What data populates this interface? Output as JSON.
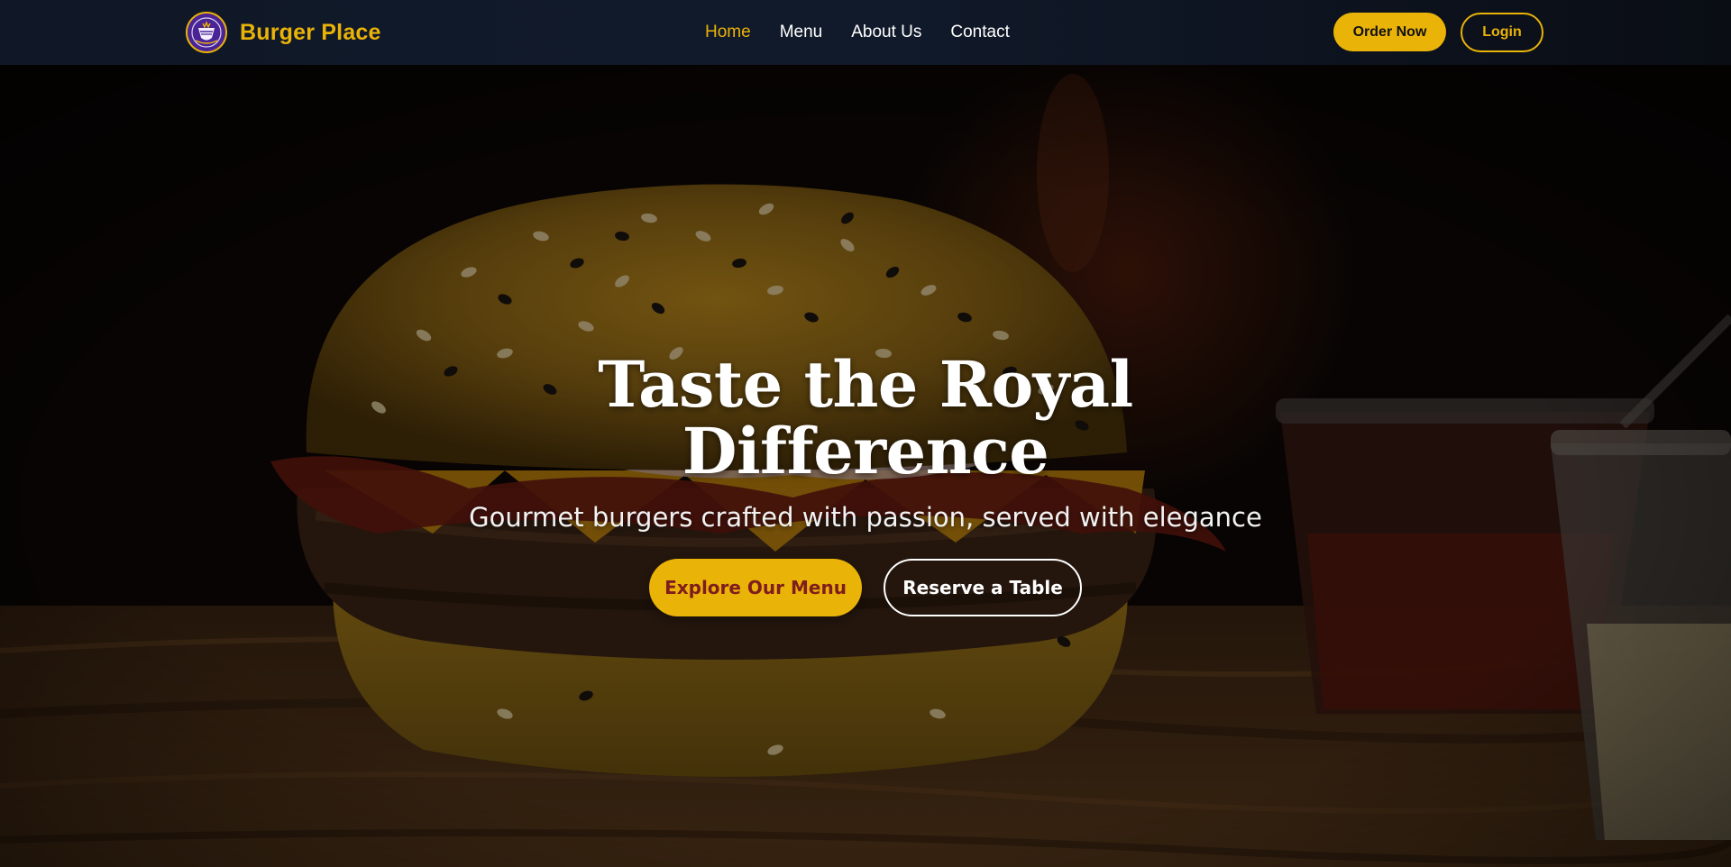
{
  "navbar": {
    "brand_name": "Burger Place",
    "links": [
      {
        "label": "Home",
        "active": true
      },
      {
        "label": "Menu",
        "active": false
      },
      {
        "label": "About Us",
        "active": false
      },
      {
        "label": "Contact",
        "active": false
      }
    ],
    "order_label": "Order Now",
    "login_label": "Login"
  },
  "hero": {
    "title": "Taste the Royal Difference",
    "subtitle": "Gourmet burgers crafted with passion, served with elegance",
    "primary_button": "Explore Our Menu",
    "secondary_button": "Reserve a Table",
    "background_image": "burger-photo"
  },
  "colors": {
    "accent": "#eab308",
    "nav_background": "#101827",
    "primary_button_text": "#7f1d1d",
    "hero_text": "#ffffff"
  },
  "icons": {
    "logo": "purple-crest-logo"
  }
}
